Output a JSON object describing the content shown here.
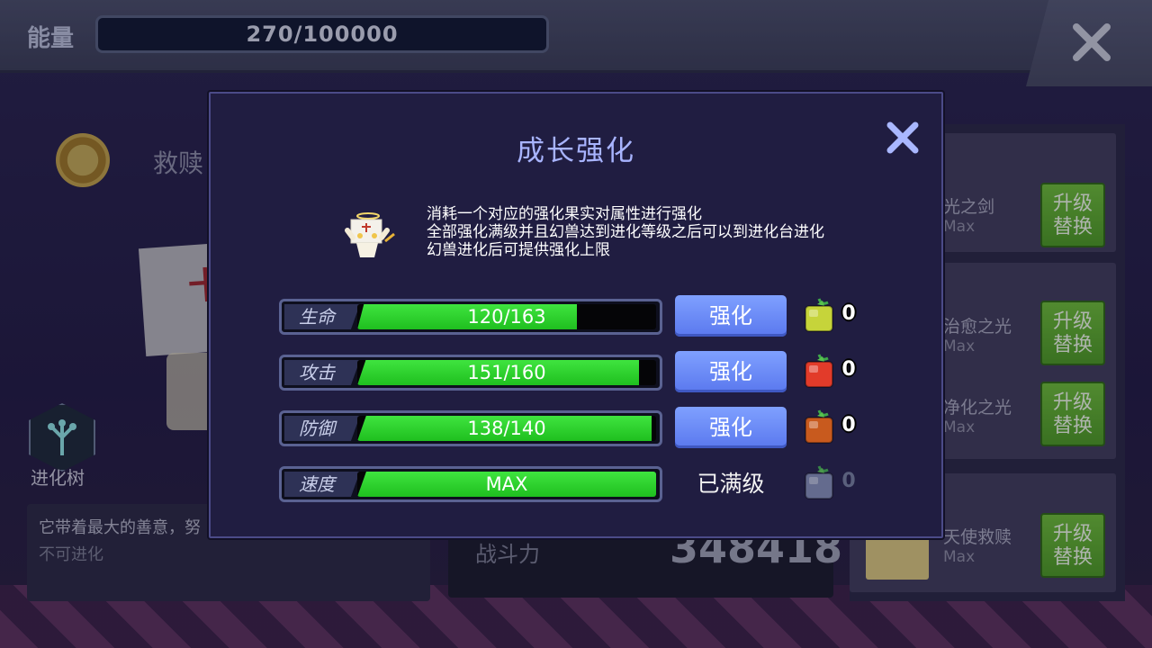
{
  "topbar": {
    "energy_label": "能量",
    "energy_value": "270/100000"
  },
  "background": {
    "character_name_partial": "救赎",
    "evolution_tree_label": "进化树",
    "description_partial": "它带着最大的善意，努",
    "evolution_status": "不可进化",
    "power_label": "战斗力",
    "power_value": "348418",
    "skills": [
      {
        "name": "光之剑",
        "level": "Max",
        "button": "升级替换"
      },
      {
        "name": "治愈之光",
        "level": "Max",
        "button": "升级替换"
      },
      {
        "name": "净化之光",
        "level": "Max",
        "button": "升级替换"
      },
      {
        "name": "天使救赎",
        "level": "Max",
        "button": "升级替换"
      }
    ]
  },
  "modal": {
    "title": "成长强化",
    "info_lines": [
      "消耗一个对应的强化果实对属性进行强化",
      "全部强化满级并且幻兽达到进化等级之后可以到进化台进化",
      "幻兽进化后可提供强化上限"
    ],
    "stats": [
      {
        "label": "生命",
        "display": "120/163",
        "fill": 0.736,
        "action": "强化",
        "fruit_color": "#c6d43a",
        "fruit_count": "0",
        "maxed": false
      },
      {
        "label": "攻击",
        "display": "151/160",
        "fill": 0.944,
        "action": "强化",
        "fruit_color": "#e23b2a",
        "fruit_count": "0",
        "maxed": false
      },
      {
        "label": "防御",
        "display": "138/140",
        "fill": 0.986,
        "action": "强化",
        "fruit_color": "#c85a1e",
        "fruit_count": "0",
        "maxed": false
      },
      {
        "label": "速度",
        "display": "MAX",
        "fill": 1.0,
        "action": "已满级",
        "fruit_color": "#7b86a8",
        "fruit_count": "0",
        "maxed": true
      }
    ]
  },
  "icons": [
    "close-icon",
    "mascot-icon",
    "fruit-icon",
    "evolution-tree-icon",
    "coin-icon"
  ]
}
